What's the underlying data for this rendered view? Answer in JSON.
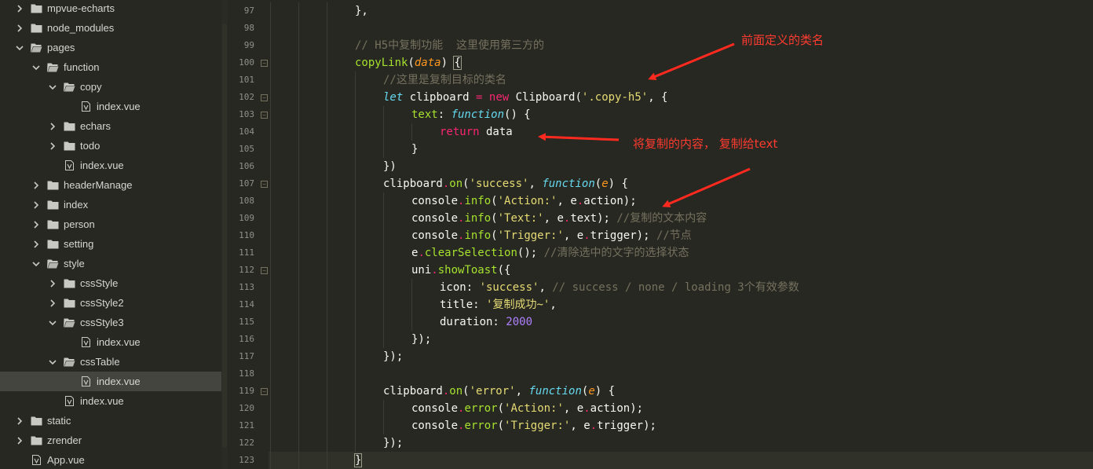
{
  "sidebar": {
    "items": [
      {
        "label": "mpvue-echarts",
        "type": "folder",
        "expanded": false,
        "depth": 0
      },
      {
        "label": "node_modules",
        "type": "folder",
        "expanded": false,
        "depth": 0
      },
      {
        "label": "pages",
        "type": "folder",
        "expanded": true,
        "depth": 0
      },
      {
        "label": "function",
        "type": "folder",
        "expanded": true,
        "depth": 1
      },
      {
        "label": "copy",
        "type": "folder",
        "expanded": true,
        "depth": 2
      },
      {
        "label": "index.vue",
        "type": "file",
        "depth": 3
      },
      {
        "label": "echars",
        "type": "folder",
        "expanded": false,
        "depth": 2
      },
      {
        "label": "todo",
        "type": "folder",
        "expanded": false,
        "depth": 2
      },
      {
        "label": "index.vue",
        "type": "file",
        "depth": 2
      },
      {
        "label": "headerManage",
        "type": "folder",
        "expanded": false,
        "depth": 1
      },
      {
        "label": "index",
        "type": "folder",
        "expanded": false,
        "depth": 1
      },
      {
        "label": "person",
        "type": "folder",
        "expanded": false,
        "depth": 1
      },
      {
        "label": "setting",
        "type": "folder",
        "expanded": false,
        "depth": 1
      },
      {
        "label": "style",
        "type": "folder",
        "expanded": true,
        "depth": 1
      },
      {
        "label": "cssStyle",
        "type": "folder",
        "expanded": false,
        "depth": 2
      },
      {
        "label": "cssStyle2",
        "type": "folder",
        "expanded": false,
        "depth": 2
      },
      {
        "label": "cssStyle3",
        "type": "folder",
        "expanded": true,
        "depth": 2
      },
      {
        "label": "index.vue",
        "type": "file",
        "depth": 3
      },
      {
        "label": "cssTable",
        "type": "folder",
        "expanded": true,
        "depth": 2
      },
      {
        "label": "index.vue",
        "type": "file",
        "depth": 3,
        "selected": true
      },
      {
        "label": "index.vue",
        "type": "file",
        "depth": 2
      },
      {
        "label": "static",
        "type": "folder",
        "expanded": false,
        "depth": 0
      },
      {
        "label": "zrender",
        "type": "folder",
        "expanded": false,
        "depth": 0
      },
      {
        "label": "App.vue",
        "type": "file",
        "depth": 0
      }
    ]
  },
  "editor": {
    "lines": [
      {
        "n": "97",
        "fold": false,
        "indent": 3,
        "tokens": [
          [
            "punc",
            "},"
          ]
        ]
      },
      {
        "n": "98",
        "fold": false,
        "indent": 3,
        "tokens": []
      },
      {
        "n": "99",
        "fold": false,
        "indent": 3,
        "tokens": [
          [
            "comment",
            "// H5中复制功能  这里使用第三方的"
          ]
        ]
      },
      {
        "n": "100",
        "fold": true,
        "indent": 3,
        "tokens": [
          [
            "fn",
            "copyLink"
          ],
          [
            "punc",
            "("
          ],
          [
            "param",
            "data"
          ],
          [
            "punc",
            ") "
          ],
          [
            "bracket",
            "{"
          ]
        ]
      },
      {
        "n": "101",
        "fold": false,
        "indent": 4,
        "tokens": [
          [
            "comment",
            "//这里是复制目标的类名"
          ]
        ]
      },
      {
        "n": "102",
        "fold": true,
        "indent": 4,
        "tokens": [
          [
            "kwit",
            "let"
          ],
          [
            "punc",
            " clipboard "
          ],
          [
            "kw",
            "="
          ],
          [
            "punc",
            " "
          ],
          [
            "kw",
            "new"
          ],
          [
            "punc",
            " Clipboard("
          ],
          [
            "str",
            "'.copy-h5'"
          ],
          [
            "punc",
            ", {"
          ]
        ]
      },
      {
        "n": "103",
        "fold": true,
        "indent": 5,
        "tokens": [
          [
            "prop",
            "text"
          ],
          [
            "punc",
            ": "
          ],
          [
            "kwit",
            "function"
          ],
          [
            "punc",
            "() {"
          ]
        ]
      },
      {
        "n": "104",
        "fold": false,
        "indent": 6,
        "tokens": [
          [
            "kw",
            "return"
          ],
          [
            "punc",
            " data"
          ]
        ]
      },
      {
        "n": "105",
        "fold": false,
        "indent": 5,
        "tokens": [
          [
            "punc",
            "}"
          ]
        ]
      },
      {
        "n": "106",
        "fold": false,
        "indent": 4,
        "tokens": [
          [
            "punc",
            "})"
          ]
        ]
      },
      {
        "n": "107",
        "fold": true,
        "indent": 4,
        "tokens": [
          [
            "punc",
            "clipboard"
          ],
          [
            "kw",
            "."
          ],
          [
            "fn",
            "on"
          ],
          [
            "punc",
            "("
          ],
          [
            "str",
            "'success'"
          ],
          [
            "punc",
            ", "
          ],
          [
            "kwit",
            "function"
          ],
          [
            "punc",
            "("
          ],
          [
            "param",
            "e"
          ],
          [
            "punc",
            ") {"
          ]
        ]
      },
      {
        "n": "108",
        "fold": false,
        "indent": 5,
        "tokens": [
          [
            "punc",
            "console"
          ],
          [
            "kw",
            "."
          ],
          [
            "fn",
            "info"
          ],
          [
            "punc",
            "("
          ],
          [
            "str",
            "'Action:'"
          ],
          [
            "punc",
            ", e"
          ],
          [
            "kw",
            "."
          ],
          [
            "punc",
            "action);"
          ]
        ]
      },
      {
        "n": "109",
        "fold": false,
        "indent": 5,
        "tokens": [
          [
            "punc",
            "console"
          ],
          [
            "kw",
            "."
          ],
          [
            "fn",
            "info"
          ],
          [
            "punc",
            "("
          ],
          [
            "str",
            "'Text:'"
          ],
          [
            "punc",
            ", e"
          ],
          [
            "kw",
            "."
          ],
          [
            "punc",
            "text); "
          ],
          [
            "comment",
            "//复制的文本内容"
          ]
        ]
      },
      {
        "n": "110",
        "fold": false,
        "indent": 5,
        "tokens": [
          [
            "punc",
            "console"
          ],
          [
            "kw",
            "."
          ],
          [
            "fn",
            "info"
          ],
          [
            "punc",
            "("
          ],
          [
            "str",
            "'Trigger:'"
          ],
          [
            "punc",
            ", e"
          ],
          [
            "kw",
            "."
          ],
          [
            "punc",
            "trigger); "
          ],
          [
            "comment",
            "//节点"
          ]
        ]
      },
      {
        "n": "111",
        "fold": false,
        "indent": 5,
        "tokens": [
          [
            "punc",
            "e"
          ],
          [
            "kw",
            "."
          ],
          [
            "fn",
            "clearSelection"
          ],
          [
            "punc",
            "(); "
          ],
          [
            "comment",
            "//清除选中的文字的选择状态"
          ]
        ]
      },
      {
        "n": "112",
        "fold": true,
        "indent": 5,
        "tokens": [
          [
            "punc",
            "uni"
          ],
          [
            "kw",
            "."
          ],
          [
            "fn",
            "showToast"
          ],
          [
            "punc",
            "({"
          ]
        ]
      },
      {
        "n": "113",
        "fold": false,
        "indent": 6,
        "tokens": [
          [
            "punc",
            "icon: "
          ],
          [
            "str",
            "'success'"
          ],
          [
            "punc",
            ", "
          ],
          [
            "comment",
            "// success / none / loading 3个有效参数"
          ]
        ]
      },
      {
        "n": "114",
        "fold": false,
        "indent": 6,
        "tokens": [
          [
            "punc",
            "title: "
          ],
          [
            "str",
            "'复制成功~'"
          ],
          [
            "punc",
            ","
          ]
        ]
      },
      {
        "n": "115",
        "fold": false,
        "indent": 6,
        "tokens": [
          [
            "punc",
            "duration: "
          ],
          [
            "num",
            "2000"
          ]
        ]
      },
      {
        "n": "116",
        "fold": false,
        "indent": 5,
        "tokens": [
          [
            "punc",
            "});"
          ]
        ]
      },
      {
        "n": "117",
        "fold": false,
        "indent": 4,
        "tokens": [
          [
            "punc",
            "});"
          ]
        ]
      },
      {
        "n": "118",
        "fold": false,
        "indent": 4,
        "tokens": []
      },
      {
        "n": "119",
        "fold": true,
        "indent": 4,
        "tokens": [
          [
            "punc",
            "clipboard"
          ],
          [
            "kw",
            "."
          ],
          [
            "fn",
            "on"
          ],
          [
            "punc",
            "("
          ],
          [
            "str",
            "'error'"
          ],
          [
            "punc",
            ", "
          ],
          [
            "kwit",
            "function"
          ],
          [
            "punc",
            "("
          ],
          [
            "param",
            "e"
          ],
          [
            "punc",
            ") {"
          ]
        ]
      },
      {
        "n": "120",
        "fold": false,
        "indent": 5,
        "tokens": [
          [
            "punc",
            "console"
          ],
          [
            "kw",
            "."
          ],
          [
            "fn",
            "error"
          ],
          [
            "punc",
            "("
          ],
          [
            "str",
            "'Action:'"
          ],
          [
            "punc",
            ", e"
          ],
          [
            "kw",
            "."
          ],
          [
            "punc",
            "action);"
          ]
        ]
      },
      {
        "n": "121",
        "fold": false,
        "indent": 5,
        "tokens": [
          [
            "punc",
            "console"
          ],
          [
            "kw",
            "."
          ],
          [
            "fn",
            "error"
          ],
          [
            "punc",
            "("
          ],
          [
            "str",
            "'Trigger:'"
          ],
          [
            "punc",
            ", e"
          ],
          [
            "kw",
            "."
          ],
          [
            "punc",
            "trigger);"
          ]
        ]
      },
      {
        "n": "122",
        "fold": false,
        "indent": 4,
        "tokens": [
          [
            "punc",
            "});"
          ]
        ]
      },
      {
        "n": "123",
        "fold": false,
        "indent": 3,
        "current": true,
        "tokens": [
          [
            "bracket",
            "}"
          ]
        ]
      }
    ]
  },
  "annotations": [
    {
      "text": "前面定义的类名"
    },
    {
      "text": "将复制的内容， 复制给text"
    }
  ],
  "colors": {
    "background": "#272822",
    "annotation": "#ff3b2f",
    "selected_row": "#44453e"
  }
}
